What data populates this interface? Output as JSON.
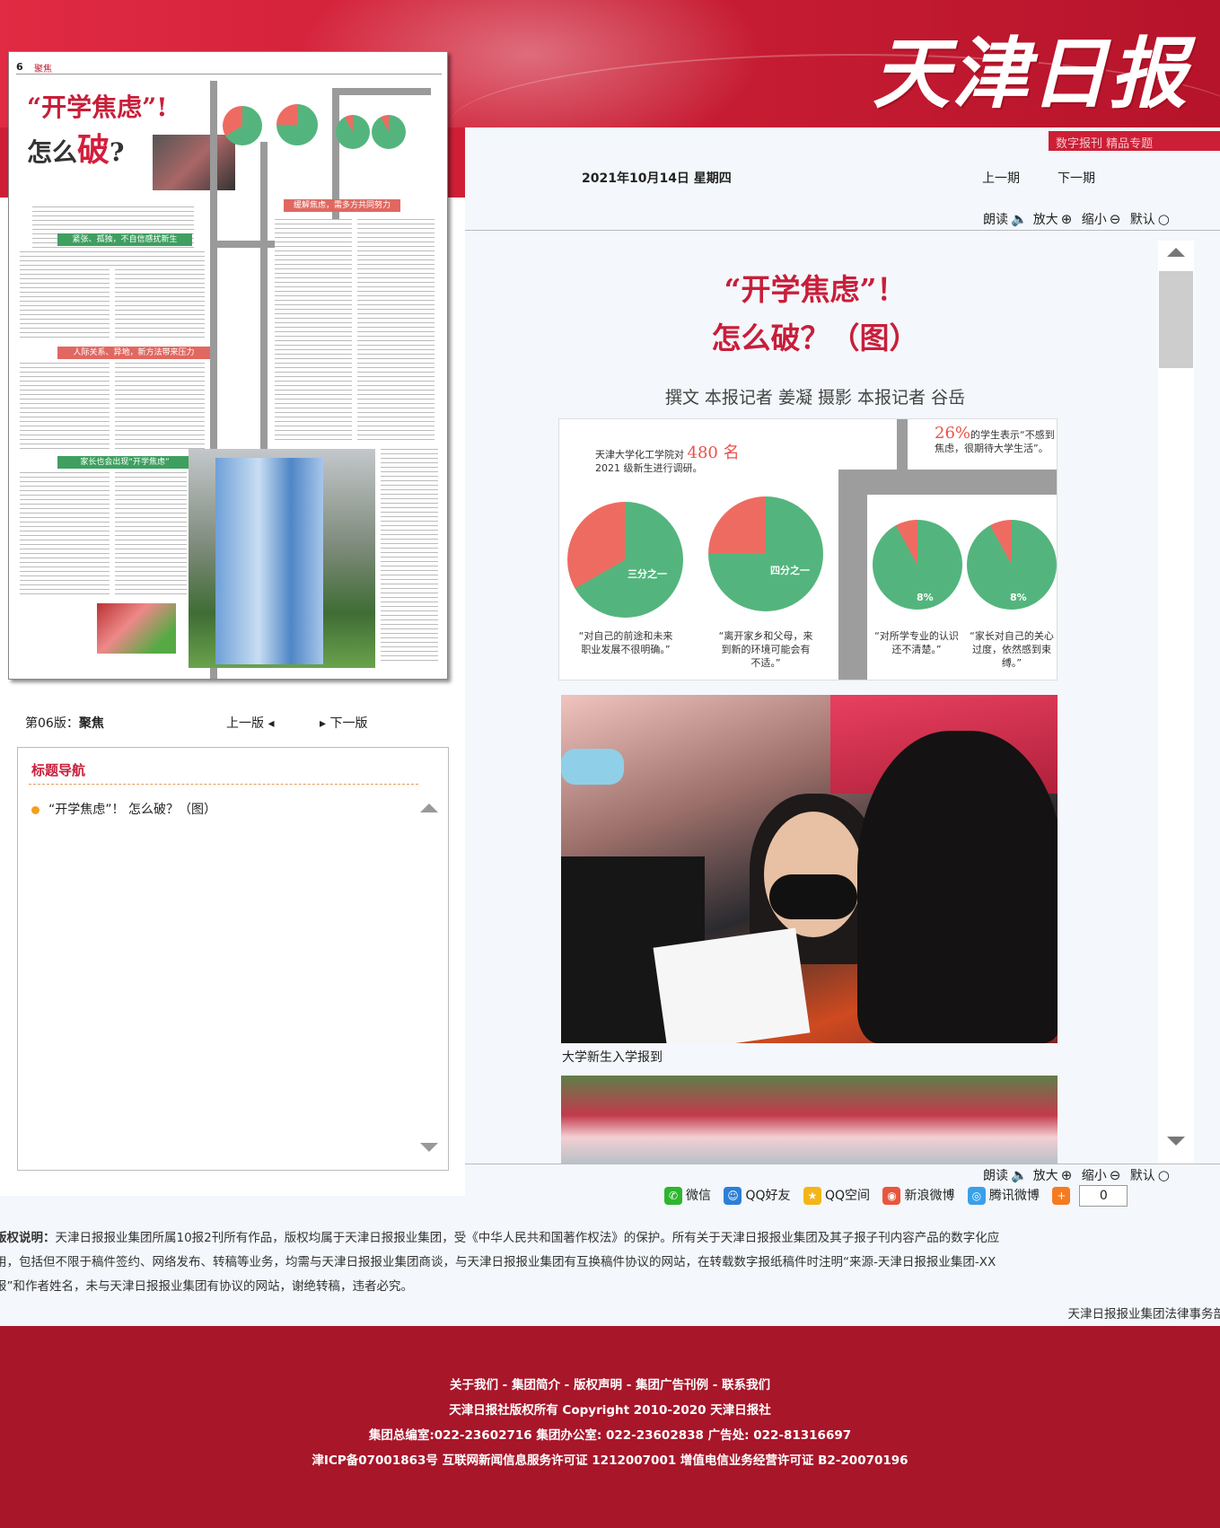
{
  "masthead": {
    "logo": "天津日报",
    "strip_text": "数字报刊   精品专题"
  },
  "page_thumb": {
    "page_num": "6",
    "section": "聚焦",
    "headline_line1": "“开学焦虑”!",
    "headline_line2_a": "怎么",
    "headline_line2_b": "破",
    "headline_line2_c": "?",
    "sub1": "紧张、孤独，不自信感扰新生",
    "sub2": "人际关系、异地，新方法带来压力",
    "sub3": "家长也会出现“开学焦虑”",
    "sub4": "缓解焦虑，需多方共同努力"
  },
  "edition_nav": {
    "label": "第06版：",
    "name": "聚焦",
    "prev": "上一版",
    "next": "下一版"
  },
  "title_nav": {
    "title": "标题导航",
    "items": [
      "“开学焦虑”！ 怎么破？（图）"
    ]
  },
  "header": {
    "date": "2021年10月14日 星期四",
    "prev_issue": "上一期",
    "next_issue": "下一期"
  },
  "tools": {
    "read": "朗读",
    "zoom_in": "放大",
    "zoom_out": "缩小",
    "default": "默认"
  },
  "article": {
    "title_line1": "“开学焦虑”！",
    "title_line2": "怎么破？（图）",
    "byline": "撰文 本报记者 姜凝 摄影 本报记者 谷岳",
    "photo1_caption": "大学新生入学报到"
  },
  "infographic": {
    "intro_a": "天津大学化工学院对",
    "intro_num": "480 名",
    "intro_b": "2021 级新生进行调研。",
    "stat_num": "26%",
    "stat_text": "的学生表示“不感到焦虑，很期待大学生活”。",
    "pie_labels": [
      "三分之一",
      "四分之一",
      "8%",
      "8%"
    ],
    "captions": [
      "“对自己的前途和未来职业发展不很明确。”",
      "“离开家乡和父母，来到新的环境可能会有不适。”",
      "“对所学专业的认识还不清楚。”",
      "“家长对自己的关心过度，依然感到束缚。”"
    ]
  },
  "chart_data": {
    "type": "pie",
    "series": [
      {
        "name": "“对自己的前途和未来职业发展不很明确。”",
        "values": [
          66.7,
          33.3
        ]
      },
      {
        "name": "“离开家乡和父母，来到新的环境可能会有不适。”",
        "values": [
          75,
          25
        ]
      },
      {
        "name": "“对所学专业的认识还不清楚。”",
        "values": [
          92,
          8
        ]
      },
      {
        "name": "“家长对自己的关心过度，依然感到束缚。”",
        "values": [
          92,
          8
        ]
      }
    ],
    "colors": [
      "#53b57d",
      "#ee6b62"
    ]
  },
  "share": {
    "wechat": "微信",
    "qq_friend": "QQ好友",
    "qzone": "QQ空间",
    "sina": "新浪微博",
    "tencent": "腾讯微博",
    "count": "0"
  },
  "copyright": {
    "lead": "版权说明：",
    "line1": "天津日报报业集团所属10报2刊所有作品，版权均属于天津日报报业集团，受《中华人民共和国著作权法》的保护。所有关于天津日报报业集团及其子报子刊内容产品的数字化应",
    "line2": "用，包括但不限于稿件签约、网络发布、转稿等业务，均需与天津日报报业集团商谈，与天津日报报业集团有互换稿件协议的网站，在转载数字报纸稿件时注明“来源-天津日报报业集团-XX",
    "line3": "报”和作者姓名，未与天津日报报业集团有协议的网站，谢绝转稿，违者必究。",
    "dept": "天津日报报业集团法律事务部"
  },
  "footer": {
    "links": "关于我们 - 集团简介 - 版权声明 - 集团广告刊例 - 联系我们",
    "rights": "天津日报社版权所有 Copyright 2010-2020 天津日报社",
    "phones": "集团总编室:022-23602716 集团办公室: 022-23602838 广告处: 022-81316697",
    "icp": "津ICP备07001863号 互联网新闻信息服务许可证 1212007001 增值电信业务经营许可证 B2-20070196"
  }
}
